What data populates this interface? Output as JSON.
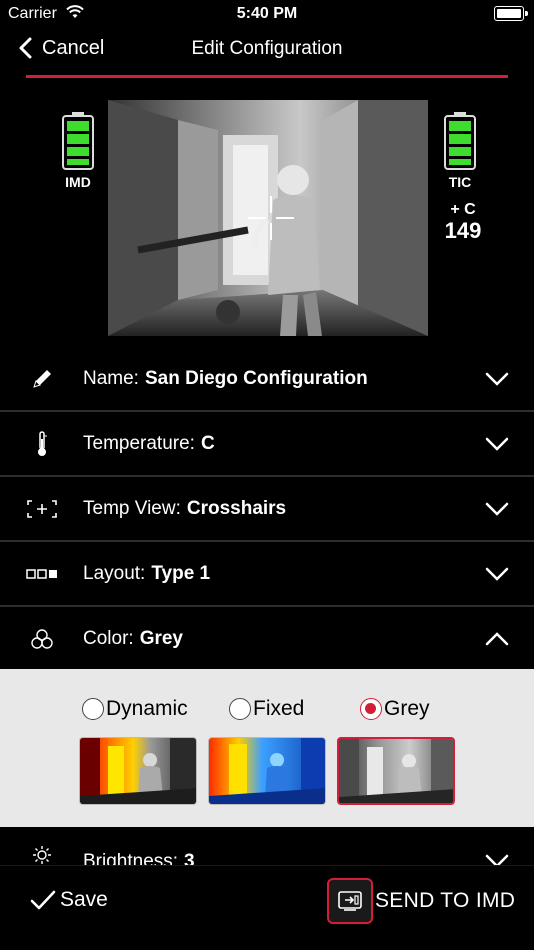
{
  "status_bar": {
    "carrier": "Carrier",
    "time": "5:40 PM"
  },
  "nav": {
    "back_label": "Cancel",
    "title": "Edit Configuration"
  },
  "preview": {
    "left_battery_label": "IMD",
    "right_battery_label": "TIC",
    "temp_unit": "+ C",
    "temp_value": "149",
    "battery_color": "#3ddc2e"
  },
  "settings": [
    {
      "label": "Name:",
      "value": "San Diego Configuration",
      "icon": "pencil-icon",
      "expanded": false
    },
    {
      "label": "Temperature:",
      "value": "C",
      "icon": "thermometer-icon",
      "expanded": false
    },
    {
      "label": "Temp View:",
      "value": "Crosshairs",
      "icon": "crosshair-bracket-icon",
      "expanded": false
    },
    {
      "label": "Layout:",
      "value": "Type 1",
      "icon": "layout-blocks-icon",
      "expanded": false
    },
    {
      "label": "Color:",
      "value": "Grey",
      "icon": "color-circles-icon",
      "expanded": true
    }
  ],
  "color_options": [
    {
      "label": "Dynamic",
      "selected": false
    },
    {
      "label": "Fixed",
      "selected": false
    },
    {
      "label": "Grey",
      "selected": true
    }
  ],
  "brightness": {
    "label": "Brightness:",
    "value": "3",
    "icon": "sun-icon"
  },
  "toolbar": {
    "save_label": "Save",
    "send_label": "SEND TO IMD"
  },
  "accent_color": "#d21f35"
}
